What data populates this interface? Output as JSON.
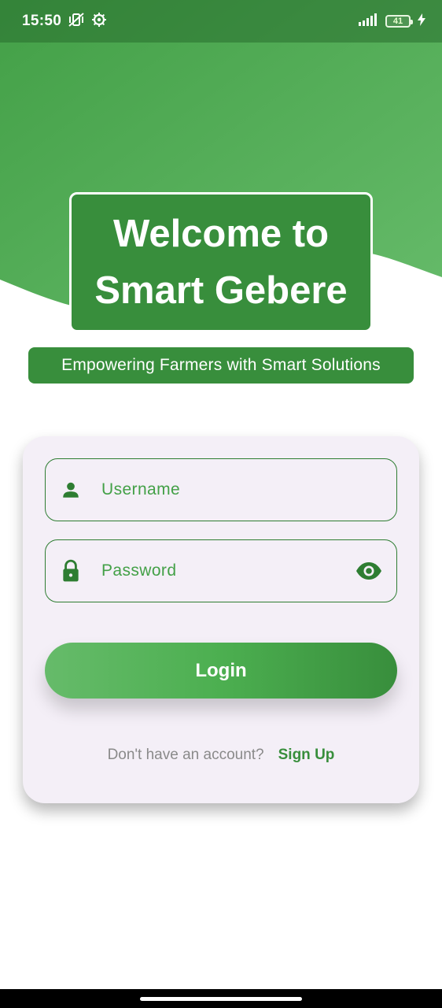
{
  "status_bar": {
    "time": "15:50",
    "battery_level": "41",
    "icons": [
      "vibrate-mute-icon",
      "settings-gear-icon",
      "signal-icon",
      "battery-icon",
      "charging-bolt-icon"
    ]
  },
  "welcome": {
    "line1": "Welcome to",
    "line2": "Smart Gebere"
  },
  "tagline": "Empowering Farmers with Smart Solutions",
  "form": {
    "username": {
      "placeholder": "Username",
      "value": "",
      "icon": "person-icon"
    },
    "password": {
      "placeholder": "Password",
      "value": "",
      "icon": "lock-icon",
      "toggle_icon": "eye-icon"
    },
    "login_label": "Login",
    "signup_prompt": "Don't have an account?",
    "signup_label": "Sign Up"
  },
  "colors": {
    "primary": "#388e3c",
    "primary_light": "#66bb6a",
    "card_background": "#f4eff7",
    "muted_text": "#8a8a8a"
  }
}
